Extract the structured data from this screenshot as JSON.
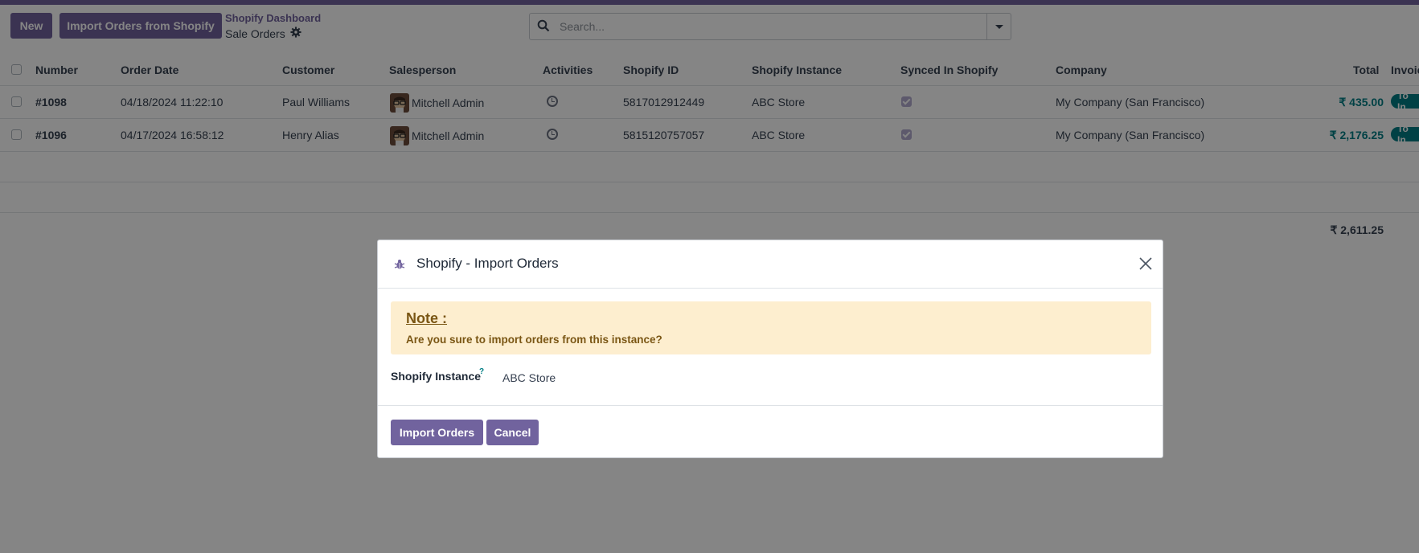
{
  "control_panel": {
    "new_label": "New",
    "import_label": "Import Orders from Shopify",
    "breadcrumb_parent": "Shopify Dashboard",
    "breadcrumb_current": "Sale Orders",
    "search_placeholder": "Search..."
  },
  "table": {
    "columns": [
      "Number",
      "Order Date",
      "Customer",
      "Salesperson",
      "Activities",
      "Shopify ID",
      "Shopify Instance",
      "Synced In Shopify",
      "Company",
      "Total",
      "Invoic"
    ],
    "rows": [
      {
        "number": "#1098",
        "order_date": "04/18/2024 11:22:10",
        "customer": "Paul Williams",
        "salesperson": "Mitchell Admin",
        "shopify_id": "5817012912449",
        "instance": "ABC Store",
        "synced": true,
        "company": "My Company (San Francisco)",
        "total": "₹ 435.00",
        "invoice_status": "To In"
      },
      {
        "number": "#1096",
        "order_date": "04/17/2024 16:58:12",
        "customer": "Henry Alias",
        "salesperson": "Mitchell Admin",
        "shopify_id": "5815120757057",
        "instance": "ABC Store",
        "synced": true,
        "company": "My Company (San Francisco)",
        "total": "₹ 2,176.25",
        "invoice_status": "To In"
      }
    ],
    "grand_total": "₹ 2,611.25"
  },
  "dialog": {
    "title": "Shopify - Import Orders",
    "note_title": "Note :",
    "note_text": "Are you sure to import orders from this instance?",
    "field_label": "Shopify Instance",
    "field_help": "?",
    "field_value": "ABC Store",
    "import_label": "Import Orders",
    "cancel_label": "Cancel"
  },
  "colors": {
    "brand": "#71639e",
    "accent": "#017e84",
    "note_bg": "#fdeecf",
    "note_text": "#7a5614"
  }
}
